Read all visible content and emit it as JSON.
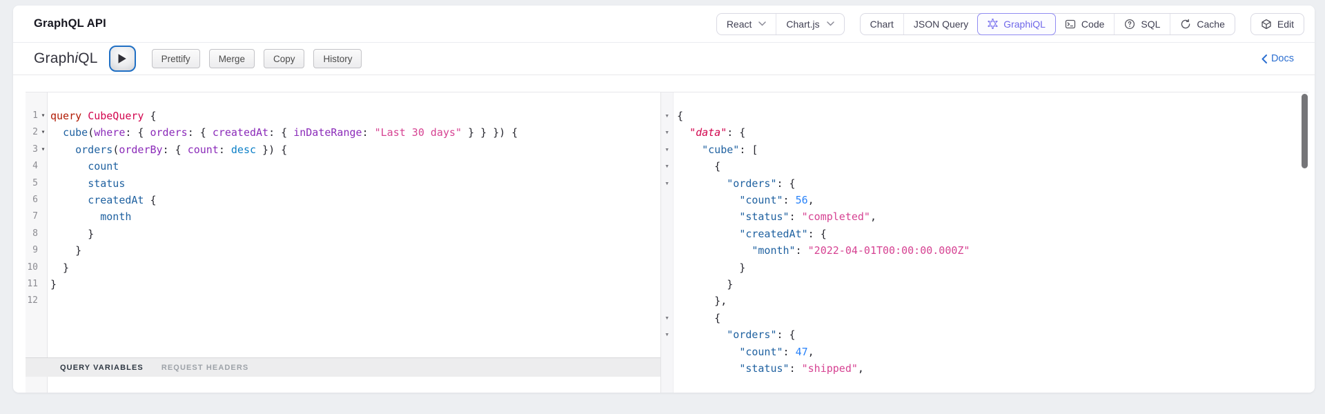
{
  "colors": {
    "kw": "#b11a04",
    "def": "#d2054e",
    "prop": "#1f61a0",
    "attr": "#8b2bb9",
    "str": "#d64292",
    "enum": "#0b7fc7",
    "num": "#2882f9",
    "punc": "#26262e",
    "selected": "#6f67e9",
    "accent_blue": "#2c6fd1"
  },
  "header": {
    "title": "GraphQL API",
    "framework_select": {
      "label": "React"
    },
    "chart_library_select": {
      "label": "Chart.js"
    },
    "tabs": [
      {
        "label": "Chart"
      },
      {
        "label": "JSON Query"
      },
      {
        "label": "GraphiQL",
        "selected": true,
        "icon": "graphql-icon"
      },
      {
        "label": "Code",
        "icon": "console-icon"
      },
      {
        "label": "SQL",
        "icon": "question-circle-icon"
      },
      {
        "label": "Cache",
        "icon": "refresh-icon"
      }
    ],
    "edit_button": {
      "label": "Edit",
      "icon": "cube-icon"
    }
  },
  "toolbar": {
    "logo": {
      "part1": "Graph",
      "part2": "i",
      "part3": "QL"
    },
    "buttons": [
      "Prettify",
      "Merge",
      "Copy",
      "History"
    ],
    "docs_label": "Docs"
  },
  "query_editor": {
    "footer_tabs": [
      {
        "label": "QUERY VARIABLES",
        "active": true
      },
      {
        "label": "REQUEST HEADERS",
        "active": false
      }
    ],
    "lines": [
      {
        "fold": true,
        "tokens": [
          [
            "query",
            "kw"
          ],
          [
            " ",
            ""
          ],
          [
            "CubeQuery",
            "def"
          ],
          [
            " {",
            ""
          ]
        ]
      },
      {
        "fold": true,
        "tokens": [
          [
            "  ",
            ""
          ],
          [
            "cube",
            "prop"
          ],
          [
            "(",
            ""
          ],
          [
            "where",
            "attr"
          ],
          [
            ": { ",
            ""
          ],
          [
            "orders",
            "attr"
          ],
          [
            ": { ",
            ""
          ],
          [
            "createdAt",
            "attr"
          ],
          [
            ": { ",
            ""
          ],
          [
            "inDateRange",
            "attr"
          ],
          [
            ": ",
            ""
          ],
          [
            "\"Last 30 days\"",
            "str"
          ],
          [
            " } } }) {",
            ""
          ]
        ]
      },
      {
        "fold": true,
        "tokens": [
          [
            "    ",
            ""
          ],
          [
            "orders",
            "prop"
          ],
          [
            "(",
            ""
          ],
          [
            "orderBy",
            "attr"
          ],
          [
            ": { ",
            ""
          ],
          [
            "count",
            "attr"
          ],
          [
            ": ",
            ""
          ],
          [
            "desc",
            "enum"
          ],
          [
            " }) {",
            ""
          ]
        ]
      },
      {
        "fold": false,
        "tokens": [
          [
            "      ",
            ""
          ],
          [
            "count",
            "prop"
          ]
        ]
      },
      {
        "fold": false,
        "tokens": [
          [
            "      ",
            ""
          ],
          [
            "status",
            "prop"
          ]
        ]
      },
      {
        "fold": false,
        "tokens": [
          [
            "      ",
            ""
          ],
          [
            "createdAt",
            "prop"
          ],
          [
            " {",
            ""
          ]
        ]
      },
      {
        "fold": false,
        "tokens": [
          [
            "        ",
            ""
          ],
          [
            "month",
            "prop"
          ]
        ]
      },
      {
        "fold": false,
        "tokens": [
          [
            "      }",
            ""
          ]
        ]
      },
      {
        "fold": false,
        "tokens": [
          [
            "    }",
            ""
          ]
        ]
      },
      {
        "fold": false,
        "tokens": [
          [
            "  }",
            ""
          ]
        ]
      },
      {
        "fold": false,
        "tokens": [
          [
            "}",
            ""
          ]
        ]
      },
      {
        "fold": false,
        "tokens": [
          [
            "",
            ""
          ]
        ]
      }
    ]
  },
  "result_viewer": {
    "lines": [
      {
        "fold": true,
        "tokens": [
          [
            "{",
            ""
          ]
        ]
      },
      {
        "fold": true,
        "tokens": [
          [
            "  ",
            ""
          ],
          [
            "\"data\"",
            "root"
          ],
          [
            ": {",
            ""
          ]
        ]
      },
      {
        "fold": true,
        "tokens": [
          [
            "    ",
            ""
          ],
          [
            "\"cube\"",
            "key"
          ],
          [
            ": [",
            ""
          ]
        ]
      },
      {
        "fold": true,
        "tokens": [
          [
            "      {",
            ""
          ]
        ]
      },
      {
        "fold": true,
        "tokens": [
          [
            "        ",
            ""
          ],
          [
            "\"orders\"",
            "key"
          ],
          [
            ": {",
            ""
          ]
        ]
      },
      {
        "fold": false,
        "tokens": [
          [
            "          ",
            ""
          ],
          [
            "\"count\"",
            "key"
          ],
          [
            ": ",
            ""
          ],
          [
            "56",
            "num"
          ],
          [
            ",",
            ""
          ]
        ]
      },
      {
        "fold": false,
        "tokens": [
          [
            "          ",
            ""
          ],
          [
            "\"status\"",
            "key"
          ],
          [
            ": ",
            ""
          ],
          [
            "\"completed\"",
            "str"
          ],
          [
            ",",
            ""
          ]
        ]
      },
      {
        "fold": false,
        "tokens": [
          [
            "          ",
            ""
          ],
          [
            "\"createdAt\"",
            "key"
          ],
          [
            ": {",
            ""
          ]
        ]
      },
      {
        "fold": false,
        "tokens": [
          [
            "            ",
            ""
          ],
          [
            "\"month\"",
            "key"
          ],
          [
            ": ",
            ""
          ],
          [
            "\"2022-04-01T00:00:00.000Z\"",
            "str"
          ]
        ]
      },
      {
        "fold": false,
        "tokens": [
          [
            "          }",
            ""
          ]
        ]
      },
      {
        "fold": false,
        "tokens": [
          [
            "        }",
            ""
          ]
        ]
      },
      {
        "fold": false,
        "tokens": [
          [
            "      },",
            ""
          ]
        ]
      },
      {
        "fold": true,
        "tokens": [
          [
            "      {",
            ""
          ]
        ]
      },
      {
        "fold": true,
        "tokens": [
          [
            "        ",
            ""
          ],
          [
            "\"orders\"",
            "key"
          ],
          [
            ": {",
            ""
          ]
        ]
      },
      {
        "fold": false,
        "tokens": [
          [
            "          ",
            ""
          ],
          [
            "\"count\"",
            "key"
          ],
          [
            ": ",
            ""
          ],
          [
            "47",
            "num"
          ],
          [
            ",",
            ""
          ]
        ]
      },
      {
        "fold": false,
        "tokens": [
          [
            "          ",
            ""
          ],
          [
            "\"status\"",
            "key"
          ],
          [
            ": ",
            ""
          ],
          [
            "\"shipped\"",
            "str"
          ],
          [
            ",",
            ""
          ]
        ]
      }
    ]
  }
}
